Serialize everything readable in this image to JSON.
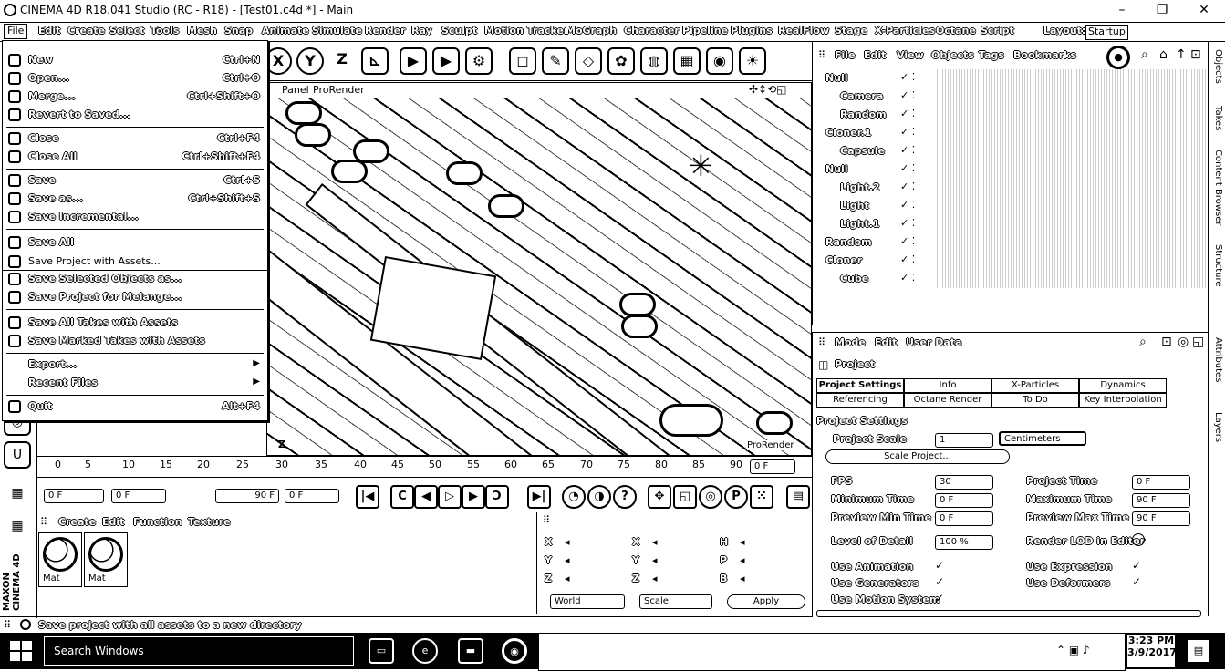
{
  "window": {
    "title": "CINEMA 4D R18.041 Studio (RC - R18) - [Test01.c4d *] - Main",
    "minimize": "–",
    "maximize": "❐",
    "close": "✕"
  },
  "menubar": [
    "File",
    "Edit",
    "Create",
    "Select",
    "Tools",
    "Mesh",
    "Snap",
    "Animate",
    "Simulate",
    "Render",
    "Ray",
    "Sculpt",
    "Motion Tracker",
    "MoGraph",
    "Character",
    "Pipeline",
    "Plugins",
    "RealFlow",
    "Stage",
    "X-Particles",
    "Octane",
    "Script",
    "Layout:",
    "Startup"
  ],
  "toolbar": {
    "x": "X",
    "y": "Y",
    "z": "Z"
  },
  "viewport": {
    "menu_panel": "Panel",
    "menu_prorender": "ProRender",
    "corner_label": "Z",
    "bottom_label": "ProRender"
  },
  "filemenu": {
    "items": [
      {
        "label": "New",
        "shortcut": "Ctrl+N"
      },
      {
        "label": "Open...",
        "shortcut": "Ctrl+O"
      },
      {
        "label": "Merge...",
        "shortcut": "Ctrl+Shift+O"
      },
      {
        "label": "Revert to Saved...",
        "shortcut": ""
      },
      {
        "label": "Close",
        "shortcut": "Ctrl+F4"
      },
      {
        "label": "Close All",
        "shortcut": "Ctrl+Shift+F4"
      },
      {
        "label": "Save",
        "shortcut": "Ctrl+S"
      },
      {
        "label": "Save as...",
        "shortcut": "Ctrl+Shift+S"
      },
      {
        "label": "Save Incremental...",
        "shortcut": ""
      },
      {
        "label": "Save All",
        "shortcut": ""
      },
      {
        "label": "Save Project with Assets...",
        "shortcut": ""
      },
      {
        "label": "Save Selected Objects as...",
        "shortcut": ""
      },
      {
        "label": "Save Project for Melange...",
        "shortcut": ""
      },
      {
        "label": "Save All Takes with Assets",
        "shortcut": ""
      },
      {
        "label": "Save Marked Takes with Assets",
        "shortcut": ""
      },
      {
        "label": "Export...",
        "shortcut": ""
      },
      {
        "label": "Recent Files",
        "shortcut": ""
      },
      {
        "label": "Quit",
        "shortcut": "Alt+F4"
      }
    ]
  },
  "timeline": {
    "ticks": [
      "0",
      "5",
      "10",
      "15",
      "20",
      "25",
      "30",
      "35",
      "40",
      "45",
      "50",
      "55",
      "60",
      "65",
      "70",
      "75",
      "80",
      "85",
      "90"
    ],
    "end_field": "0 F"
  },
  "transport": {
    "current_frame": "0 F",
    "range_start": "0 F",
    "range_end": "90 F",
    "preview": "0 F"
  },
  "materials": {
    "menu": [
      "Create",
      "Edit",
      "Function",
      "Texture"
    ],
    "items": [
      {
        "name": "Mat"
      },
      {
        "name": "Mat"
      }
    ]
  },
  "coordinates": {
    "rows": [
      {
        "a": "X",
        "b": "X",
        "c": "H"
      },
      {
        "a": "Y",
        "b": "Y",
        "c": "P"
      },
      {
        "a": "Z",
        "b": "Z",
        "c": "B"
      }
    ],
    "mode_select": "World",
    "scale_select": "Scale",
    "apply": "Apply"
  },
  "objects": {
    "menu": [
      "File",
      "Edit",
      "View",
      "Objects",
      "Tags",
      "Bookmarks"
    ],
    "items": [
      {
        "name": "Null",
        "indent": 0
      },
      {
        "name": "Camera",
        "indent": 1
      },
      {
        "name": "Random",
        "indent": 1
      },
      {
        "name": "Cloner.1",
        "indent": 0
      },
      {
        "name": "Capsule",
        "indent": 1
      },
      {
        "name": "Null",
        "indent": 0
      },
      {
        "name": "Light.2",
        "indent": 1
      },
      {
        "name": "Light",
        "indent": 1
      },
      {
        "name": "Light.1",
        "indent": 1
      },
      {
        "name": "Random",
        "indent": 0
      },
      {
        "name": "Cloner",
        "indent": 0
      },
      {
        "name": "Cube",
        "indent": 1
      }
    ]
  },
  "attributes": {
    "menu": [
      "Mode",
      "Edit",
      "User Data"
    ],
    "header": "Project",
    "tabs_row1": [
      "Project Settings",
      "Info",
      "X-Particles",
      "Dynamics"
    ],
    "tabs_row2": [
      "Referencing",
      "Octane Render",
      "To Do",
      "Key Interpolation"
    ],
    "section": "Project Settings",
    "project_scale_label": "Project Scale",
    "project_scale_value": "1",
    "project_scale_unit": "Centimeters",
    "scale_project_button": "Scale Project...",
    "params": [
      {
        "label": "FPS",
        "value": "30",
        "label2": "Project Time",
        "value2": "0 F"
      },
      {
        "label": "Minimum Time",
        "value": "0 F",
        "label2": "Maximum Time",
        "value2": "90 F"
      },
      {
        "label": "Preview Min Time",
        "value": "0 F",
        "label2": "Preview Max Time",
        "value2": "90 F"
      }
    ],
    "lod_label": "Level of Detail",
    "lod_value": "100 %",
    "render_lod_label": "Render LOD in Editor",
    "checks": [
      {
        "label": "Use Animation",
        "label2": "Use Expression"
      },
      {
        "label": "Use Generators",
        "label2": "Use Deformers"
      },
      {
        "label": "Use Motion System",
        "label2": ""
      }
    ]
  },
  "right_tabs": [
    "Objects",
    "Takes",
    "Content Browser",
    "Structure",
    "Attributes",
    "Layers"
  ],
  "statusbar": {
    "text": "Save project with all assets to a new directory"
  },
  "taskbar": {
    "search": "Search Windows",
    "time": "3:23 PM",
    "date": "3/9/2017"
  }
}
